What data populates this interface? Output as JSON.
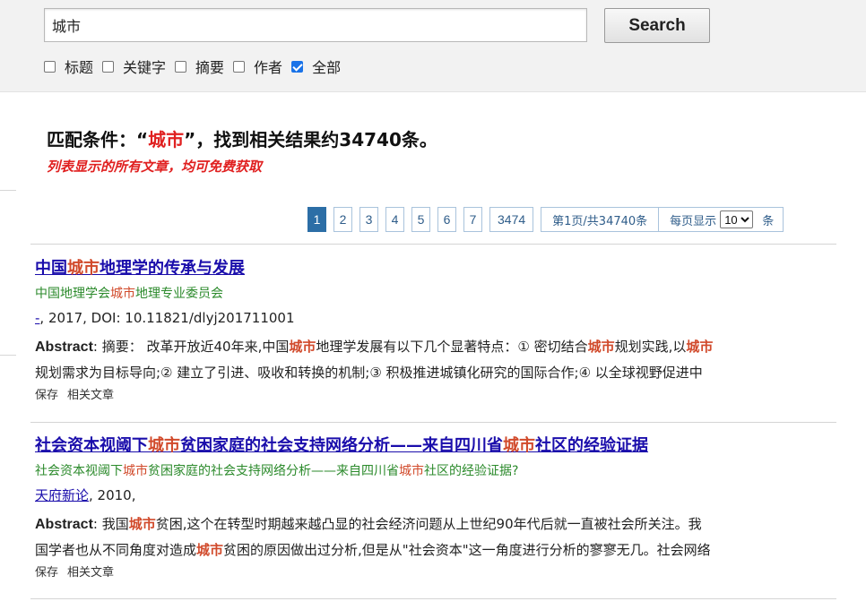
{
  "search": {
    "value": "城市",
    "button_label": "Search"
  },
  "filters": [
    {
      "label": "标题",
      "checked": false
    },
    {
      "label": "关键字",
      "checked": false
    },
    {
      "label": "摘要",
      "checked": false
    },
    {
      "label": "作者",
      "checked": false
    },
    {
      "label": "全部",
      "checked": true
    }
  ],
  "summary": {
    "prefix": "匹配条件：“",
    "keyword": "城市",
    "suffix": "”，找到相关结果约34740条。",
    "notice": "列表显示的所有文章，均可免费获取"
  },
  "pagination": {
    "pages": [
      "1",
      "2",
      "3",
      "4",
      "5",
      "6",
      "7",
      "3474"
    ],
    "current": "1",
    "info": "第1页/共34740条",
    "per_page_label": "每页显示",
    "per_page_value": "10",
    "per_page_unit": "条"
  },
  "results": [
    {
      "title_parts": [
        "中国",
        "城市",
        "地理学的传承与发展"
      ],
      "source_parts": [
        "中国地理学会",
        "城市",
        "地理专业委员会"
      ],
      "meta_link": "-",
      "meta_text": ", 2017, DOI: 10.11821/dlyj201711001",
      "abstract_label": "Abstract",
      "abstract_line1_parts": [
        ": 摘要：  改革开放近40年来,中国",
        "城市",
        "地理学发展有以下几个显著特点：① 密切结合",
        "城市",
        "规划实践,以",
        "城市"
      ],
      "abstract_line2": "规划需求为目标导向;② 建立了引进、吸收和转换的机制;③ 积极推进城镇化研究的国际合作;④ 以全球视野促进中",
      "actions": [
        "保存",
        "相关文章"
      ]
    },
    {
      "title_parts": [
        "社会资本视阈下",
        "城市",
        "贫困家庭的社会支持网络分析——来自四川省",
        "城市",
        "社区的经验证据"
      ],
      "source_parts": [
        "社会资本视阈下",
        "城市",
        "贫困家庭的社会支持网络分析——来自四川省",
        "城市",
        "社区的经验证据?"
      ],
      "meta_link": "天府新论",
      "meta_text": ", 2010,",
      "abstract_label": "Abstract",
      "abstract_line1_parts": [
        ": 我国",
        "城市",
        "贫困,这个在转型时期越来越凸显的社会经济问题从上世纪90年代后就一直被社会所关注。我"
      ],
      "abstract_line2_parts": [
        "国学者也从不同角度对造成",
        "城市",
        "贫困的原因做出过分析,但是从\"社会资本\"这一角度进行分析的寥寥无几。社会网络"
      ],
      "actions": [
        "保存",
        "相关文章"
      ]
    }
  ],
  "colors": {
    "highlight": "#d14a2b",
    "title_link": "#1a0dab",
    "source_green": "#2b8a2b",
    "notice_red": "#e02020",
    "pager_active": "#2c6ea6"
  }
}
